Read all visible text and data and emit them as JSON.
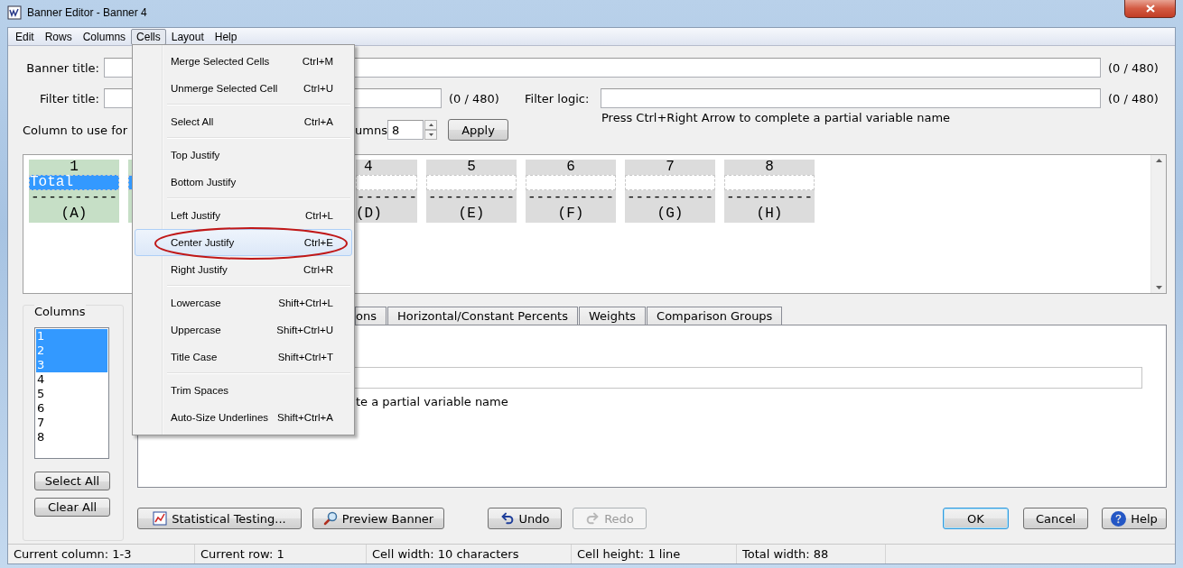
{
  "window": {
    "title": "Banner Editor - Banner 4"
  },
  "menu_bar": [
    {
      "label": "Edit",
      "open": false
    },
    {
      "label": "Rows",
      "open": false
    },
    {
      "label": "Columns",
      "open": false
    },
    {
      "label": "Cells",
      "open": true
    },
    {
      "label": "Layout",
      "open": false
    },
    {
      "label": "Help",
      "open": false
    }
  ],
  "cells_menu": [
    {
      "kind": "item",
      "label": "Merge Selected Cells",
      "shortcut": "Ctrl+M",
      "highlighted": false,
      "circled": false
    },
    {
      "kind": "item",
      "label": "Unmerge Selected Cell",
      "shortcut": "Ctrl+U",
      "highlighted": false,
      "circled": false
    },
    {
      "kind": "separator"
    },
    {
      "kind": "item",
      "label": "Select All",
      "shortcut": "Ctrl+A",
      "highlighted": false,
      "circled": false
    },
    {
      "kind": "separator"
    },
    {
      "kind": "item",
      "label": "Top Justify",
      "highlighted": false,
      "circled": false
    },
    {
      "kind": "item",
      "label": "Bottom Justify",
      "highlighted": false,
      "circled": false
    },
    {
      "kind": "separator"
    },
    {
      "kind": "item",
      "label": "Left Justify",
      "shortcut": "Ctrl+L",
      "highlighted": false,
      "circled": false
    },
    {
      "kind": "item",
      "label": "Center Justify",
      "shortcut": "Ctrl+E",
      "highlighted": true,
      "circled": true
    },
    {
      "kind": "item",
      "label": "Right Justify",
      "shortcut": "Ctrl+R",
      "highlighted": false,
      "circled": false
    },
    {
      "kind": "separator"
    },
    {
      "kind": "item",
      "label": "Lowercase",
      "shortcut": "Shift+Ctrl+L",
      "highlighted": false,
      "circled": false
    },
    {
      "kind": "item",
      "label": "Uppercase",
      "shortcut": "Shift+Ctrl+U",
      "highlighted": false,
      "circled": false
    },
    {
      "kind": "item",
      "label": "Title Case",
      "shortcut": "Shift+Ctrl+T",
      "highlighted": false,
      "circled": false
    },
    {
      "kind": "separator"
    },
    {
      "kind": "item",
      "label": "Trim Spaces",
      "highlighted": false,
      "circled": false
    },
    {
      "kind": "item",
      "label": "Auto-Size Underlines",
      "shortcut": "Shift+Ctrl+A",
      "highlighted": false,
      "circled": false
    }
  ],
  "banner_title": {
    "label": "Banner title:",
    "counter": "(0 / 480)"
  },
  "filter_title": {
    "label": "Filter title:",
    "counter": "(0 / 480)"
  },
  "filter_logic": {
    "label": "Filter logic:",
    "counter": "(0 / 480)",
    "hint": "Press Ctrl+Right Arrow to complete a partial variable name"
  },
  "column_setting": {
    "label": "Column to use for",
    "label_2": "umns",
    "value": "8",
    "apply": "Apply"
  },
  "banner_grid": [
    {
      "kind": "full",
      "selected": true,
      "number": "1",
      "label": "Total",
      "underline": "----------",
      "letter": "(A)"
    },
    {
      "kind": "sliver",
      "selected": true
    },
    {
      "kind": "clipped",
      "selected": false,
      "number": "4",
      "underline": "-------",
      "letter": "(D)"
    },
    {
      "kind": "full",
      "selected": false,
      "number": "5",
      "underline": "----------",
      "letter": "(E)"
    },
    {
      "kind": "full",
      "selected": false,
      "number": "6",
      "underline": "----------",
      "letter": "(F)"
    },
    {
      "kind": "full",
      "selected": false,
      "number": "7",
      "underline": "----------",
      "letter": "(G)"
    },
    {
      "kind": "full",
      "selected": false,
      "number": "8",
      "underline": "----------",
      "letter": "(H)"
    }
  ],
  "columns_group": {
    "title": "Columns",
    "items": [
      {
        "label": "1",
        "selected": true
      },
      {
        "label": "2",
        "selected": true
      },
      {
        "label": "3",
        "selected": true
      },
      {
        "label": "4",
        "selected": false
      },
      {
        "label": "5",
        "selected": false
      },
      {
        "label": "6",
        "selected": false
      },
      {
        "label": "7",
        "selected": false
      },
      {
        "label": "8",
        "selected": false
      }
    ],
    "buttons": [
      "Select All",
      "Clear All"
    ]
  },
  "tabs": [
    {
      "label": "ons",
      "selected": false
    },
    {
      "label": "Horizontal/Constant Percents",
      "selected": false
    },
    {
      "label": "Weights",
      "selected": false
    },
    {
      "label": "Comparison Groups",
      "selected": false
    }
  ],
  "tab_panel": {
    "hint": "te a partial variable name"
  },
  "buttons": [
    {
      "kind": "stats",
      "label": "Statistical Testing...",
      "disabled": false,
      "default": false
    },
    {
      "kind": "preview",
      "label": "Preview Banner",
      "disabled": false,
      "default": false
    },
    {
      "kind": "undo",
      "label": "Undo",
      "disabled": false,
      "default": false
    },
    {
      "kind": "redo",
      "label": "Redo",
      "disabled": true,
      "default": false
    },
    {
      "kind": "ok",
      "label": "OK",
      "disabled": false,
      "default": true
    },
    {
      "kind": "cancel",
      "label": "Cancel",
      "disabled": false,
      "default": false
    },
    {
      "kind": "help",
      "label": "Help",
      "disabled": false,
      "default": false
    }
  ],
  "status_bar": [
    "Current column: 1-3",
    "Current row: 1",
    "Cell width: 10 characters",
    "Cell height: 1 line",
    "Total width: 88"
  ]
}
